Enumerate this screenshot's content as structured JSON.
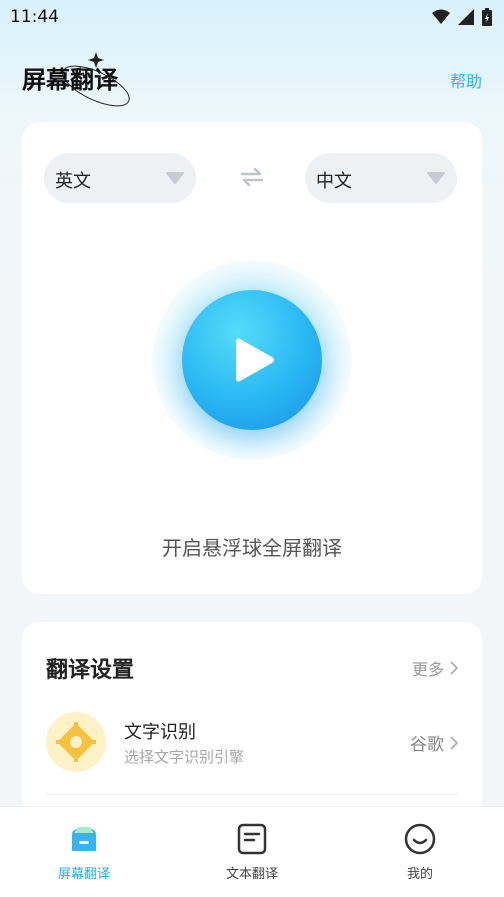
{
  "status_bar": {
    "time": "11:44"
  },
  "header": {
    "title": "屏幕翻译",
    "help": "帮助"
  },
  "translate": {
    "source_lang": "英文",
    "target_lang": "中文",
    "play_caption": "开启悬浮球全屏翻译"
  },
  "settings": {
    "title": "翻译设置",
    "more": "更多",
    "ocr": {
      "title": "文字识别",
      "subtitle": "选择文字识别引擎",
      "value": "谷歌"
    }
  },
  "bottom_nav": {
    "items": [
      {
        "label": "屏幕翻译",
        "icon": "screen-translate-icon",
        "active": true
      },
      {
        "label": "文本翻译",
        "icon": "text-translate-icon",
        "active": false
      },
      {
        "label": "我的",
        "icon": "profile-icon",
        "active": false
      }
    ]
  },
  "colors": {
    "accent": "#28a9e8",
    "play_start": "#55dcf9",
    "play_end": "#1a8fe6",
    "ocr_icon": "#f6c13c"
  }
}
